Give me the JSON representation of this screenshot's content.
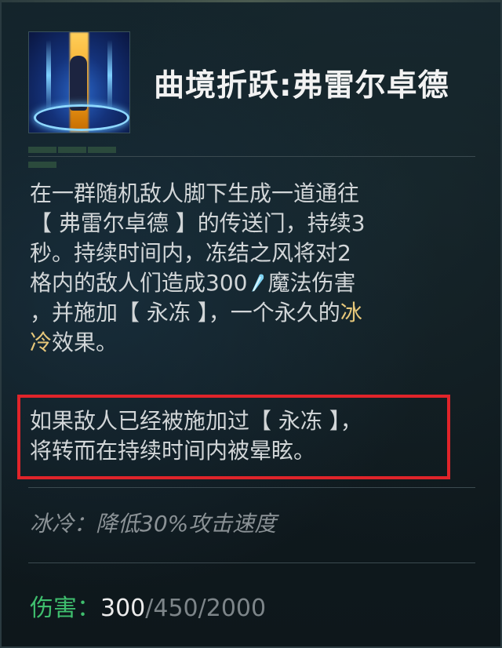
{
  "ability": {
    "name": "曲境折跃:弗雷尔卓德",
    "icon": "portal-ability-icon"
  },
  "description": {
    "line1": "在一群随机敌人脚下生成一道通往",
    "line2": "【 弗雷尔卓德 】的传送门，持续3",
    "line3": "秒。持续时间内，冻结之风将对2",
    "line4_a": "格内的敌人们造成300",
    "line4_icon": "magic-damage-icon",
    "line4_b": "魔法伤害",
    "line5_a": "，并施加【 永冻 】，一个永久的",
    "line5_kw": "冰",
    "line6_kw": "冷",
    "line6_b": "效果。"
  },
  "note": {
    "line1": "如果敌人已经被施加过【 永冻 】，",
    "line2": "将转而在持续时间内被晕眩。"
  },
  "chill": {
    "text": "冰冷：降低30%攻击速度"
  },
  "damage": {
    "label": "伤害：",
    "value_current": "300",
    "value_rest": "/450/2000"
  },
  "colors": {
    "keyword": "#e6c77a",
    "damage_label": "#3fbf6e",
    "highlight_box": "#e0242a"
  }
}
